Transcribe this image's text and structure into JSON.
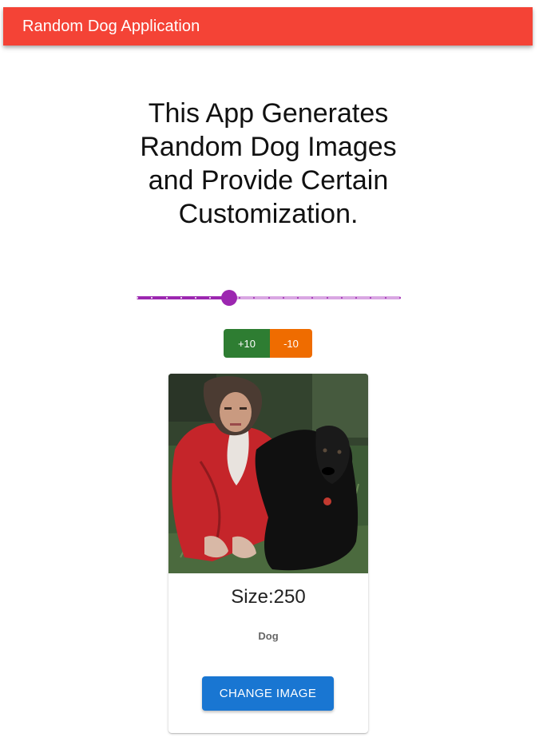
{
  "app_bar": {
    "title": "Random Dog Application",
    "color": "#f44336"
  },
  "headline": "This App Generates Random Dog Images and Provide Certain Customization.",
  "slider": {
    "value_fraction": 0.35,
    "tick_count": 19,
    "color": "#9c27b0"
  },
  "buttons": {
    "increase_label": "+10",
    "decrease_label": "-10",
    "increase_color": "#2e7d32",
    "decrease_color": "#ef6c00"
  },
  "card": {
    "image_alt": "Dog",
    "size_text": "Size:250",
    "caption": "Dog",
    "change_button_label": "CHANGE IMAGE",
    "change_button_color": "#1976d2"
  }
}
